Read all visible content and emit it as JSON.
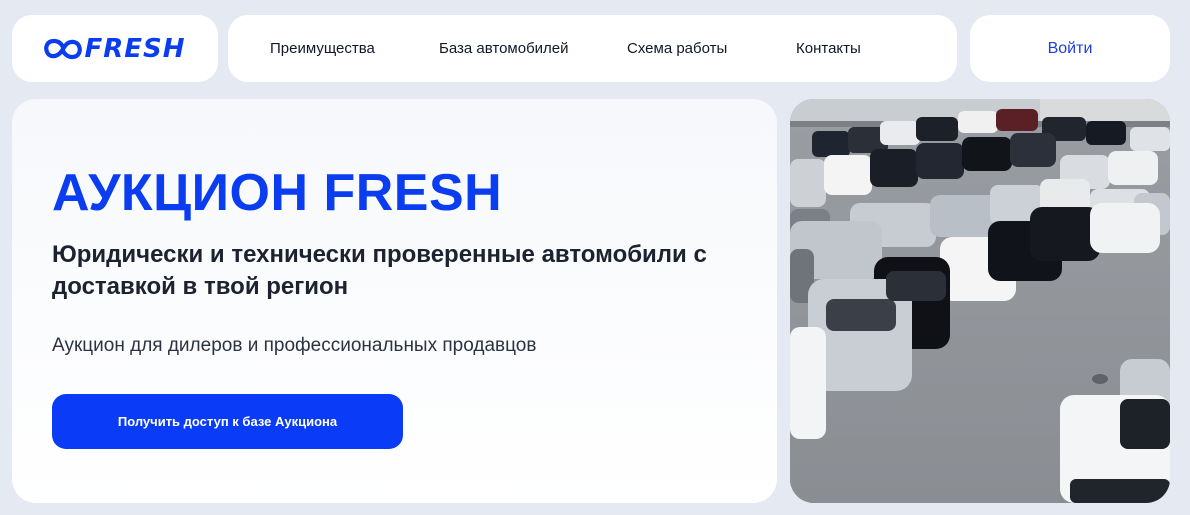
{
  "logo": {
    "text": "FRESH",
    "icon": "infinity-icon",
    "color": "#0a3cf0"
  },
  "nav": {
    "items": [
      {
        "label": "Преимущества"
      },
      {
        "label": "База автомобилей"
      },
      {
        "label": "Схема работы"
      },
      {
        "label": "Контакты"
      }
    ]
  },
  "login": {
    "label": "Войти"
  },
  "hero": {
    "title": "АУКЦИОН FRESH",
    "subtitle": "Юридически и технически проверенные автомобили с доставкой в твой регион",
    "description": "Аукцион для дилеров и профессиональных продавцов",
    "cta_label": "Получить доступ к базе Аукциона"
  },
  "colors": {
    "accent": "#0a3cf0",
    "background": "#e4e9f2",
    "card": "#ffffff",
    "text": "#1c2230"
  }
}
